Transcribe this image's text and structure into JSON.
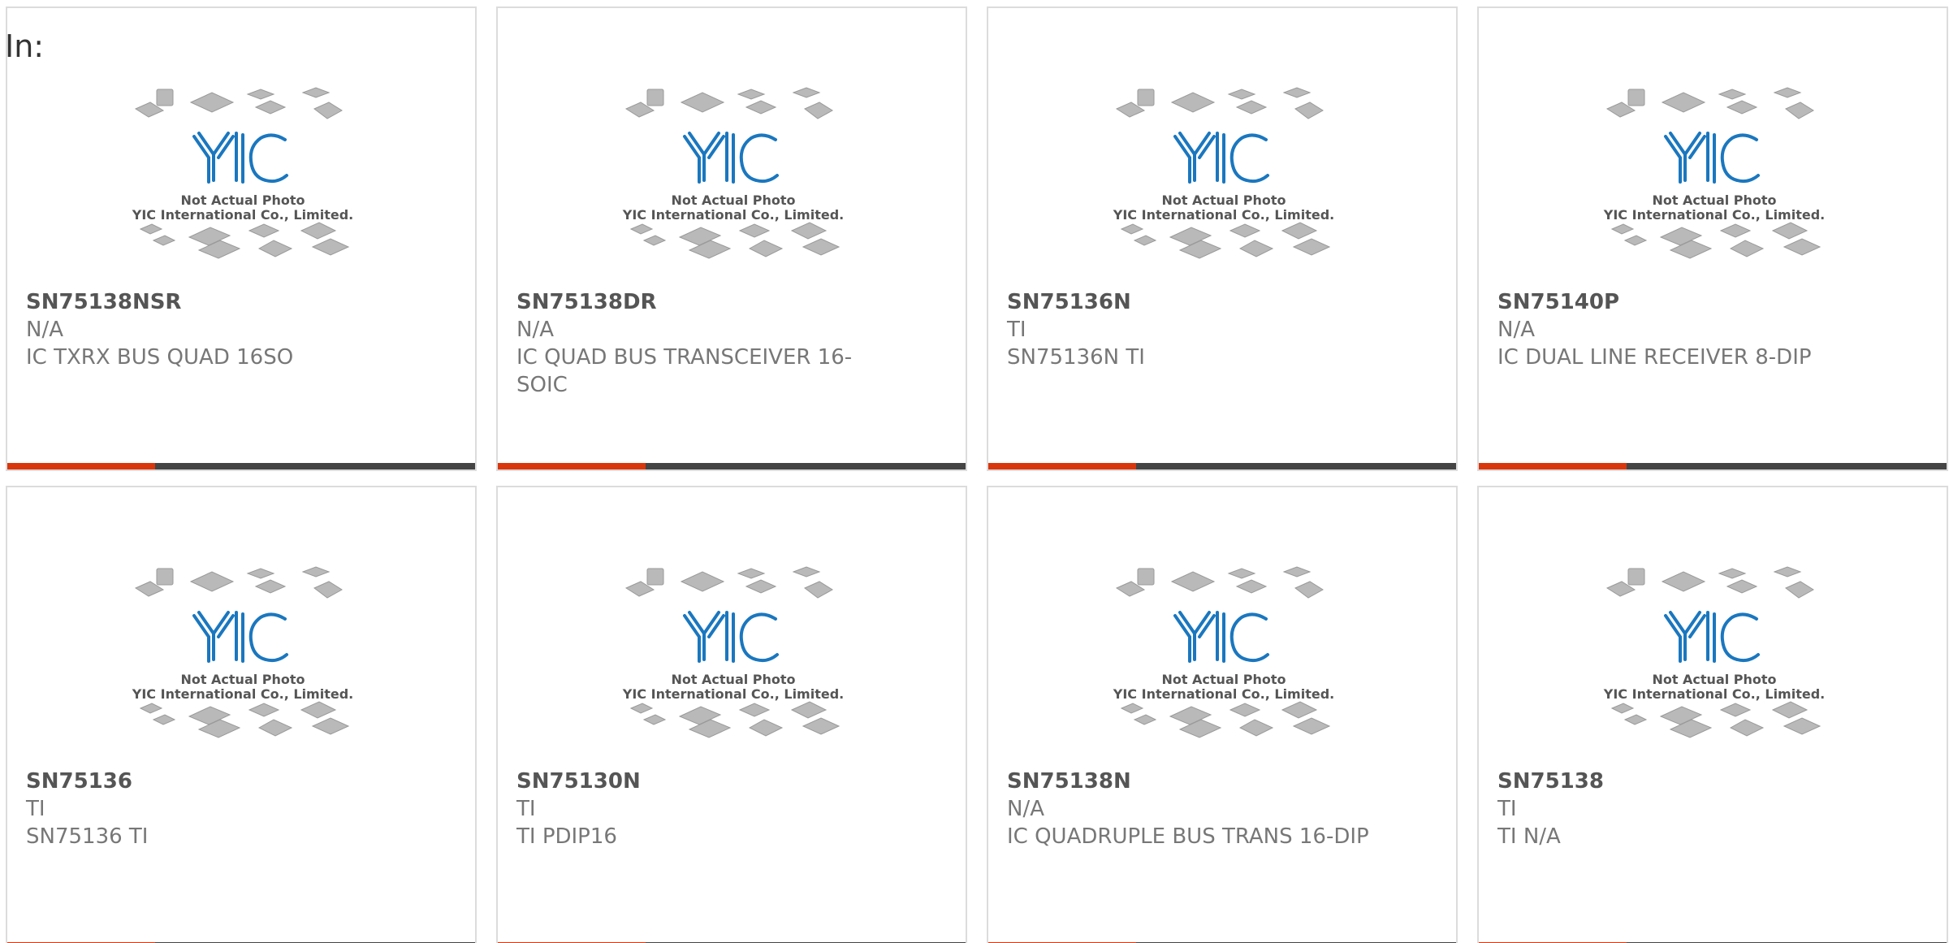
{
  "header": {
    "prefix": "In:"
  },
  "placeholder": {
    "logo": "YIC",
    "line1": "Not Actual Photo",
    "line2": "YIC International Co., Limited."
  },
  "colors": {
    "accent": "#d9360c",
    "bar": "#444444",
    "logo": "#1a77bf"
  },
  "products": [
    {
      "part": "SN75138NSR",
      "manufacturer": "N/A",
      "description": "IC TXRX BUS QUAD 16SO"
    },
    {
      "part": "SN75138DR",
      "manufacturer": "N/A",
      "description": "IC QUAD BUS TRANSCEIVER 16-SOIC"
    },
    {
      "part": "SN75136N",
      "manufacturer": "TI",
      "description": "SN75136N TI"
    },
    {
      "part": "SN75140P",
      "manufacturer": "N/A",
      "description": "IC DUAL LINE RECEIVER 8-DIP"
    },
    {
      "part": "SN75136",
      "manufacturer": "TI",
      "description": "SN75136 TI"
    },
    {
      "part": "SN75130N",
      "manufacturer": "TI",
      "description": "TI PDIP16"
    },
    {
      "part": "SN75138N",
      "manufacturer": "N/A",
      "description": "IC QUADRUPLE BUS TRANS 16-DIP"
    },
    {
      "part": "SN75138",
      "manufacturer": "TI",
      "description": "TI N/A"
    }
  ]
}
